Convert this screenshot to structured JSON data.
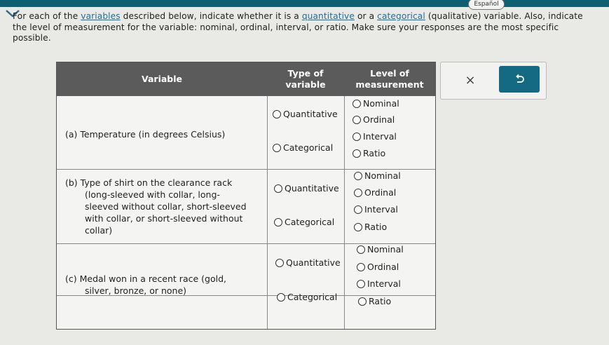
{
  "header": {
    "language_button": "Español"
  },
  "instructions": {
    "part1": "For each of the ",
    "link1": "variables",
    "part2": " described below, indicate whether it is a ",
    "link2": "quantitative",
    "part3": " or a ",
    "link3": "categorical",
    "part4": " (qualitative) variable. Also, indicate the level of measurement for the variable: nominal, ordinal, interval, or ratio. Make sure your responses are the most specific possible."
  },
  "table": {
    "headers": {
      "variable": "Variable",
      "type": "Type of variable",
      "level": "Level of measurement"
    },
    "rows": [
      {
        "variable": "(a) Temperature (in degrees Celsius)",
        "types": [
          "Quantitative",
          "Categorical"
        ],
        "levels": [
          "Nominal",
          "Ordinal",
          "Interval",
          "Ratio"
        ]
      },
      {
        "variable": "(b) Type of shirt on the clearance rack (long-sleeved with collar, long-sleeved without collar, short-sleeved with collar, or short-sleeved without collar)",
        "variable_lines": [
          "(b) Type of shirt on the clearance rack",
          "(long-sleeved with collar, long-",
          "sleeved without collar, short-sleeved",
          "with collar, or short-sleeved without",
          "collar)"
        ],
        "types": [
          "Quantitative",
          "Categorical"
        ],
        "levels": [
          "Nominal",
          "Ordinal",
          "Interval",
          "Ratio"
        ]
      },
      {
        "variable": "(c) Medal won in a recent race (gold, silver, bronze, or none)",
        "variable_lines": [
          "(c) Medal won in a recent race (gold,",
          "silver, bronze, or none)"
        ],
        "types": [
          "Quantitative",
          "Categorical"
        ],
        "levels": [
          "Nominal",
          "Ordinal",
          "Interval",
          "Ratio"
        ]
      }
    ]
  },
  "actions": {
    "clear_symbol": "×",
    "undo_icon": "undo-icon"
  },
  "colors": {
    "top_bar": "#0f5f73",
    "header_bg": "#5b5b5b",
    "link": "#1d6f9a",
    "undo_button": "#136a82"
  }
}
